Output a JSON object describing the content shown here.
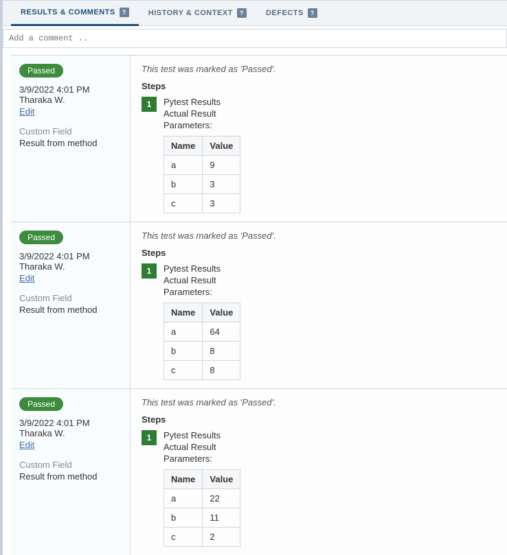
{
  "tabs": {
    "results": "RESULTS & COMMENTS",
    "history": "HISTORY & CONTEXT",
    "defects": "DEFECTS",
    "help_glyph": "?"
  },
  "comment_placeholder": "Add a comment ..",
  "labels": {
    "edit": "Edit",
    "custom_field": "Custom Field",
    "steps": "Steps",
    "name_header": "Name",
    "value_header": "Value"
  },
  "results": [
    {
      "status": "Passed",
      "timestamp": "3/9/2022 4:01 PM Tharaka W.",
      "custom_field_value": "Result from method",
      "marked_text": "This test was marked as 'Passed'.",
      "step_number": "1",
      "step_title": "Pytest Results",
      "step_sub": "Actual Result",
      "params_label": "Parameters:",
      "params": [
        {
          "name": "a",
          "value": "9"
        },
        {
          "name": "b",
          "value": "3"
        },
        {
          "name": "c",
          "value": "3"
        }
      ]
    },
    {
      "status": "Passed",
      "timestamp": "3/9/2022 4:01 PM Tharaka W.",
      "custom_field_value": "Result from method",
      "marked_text": "This test was marked as 'Passed'.",
      "step_number": "1",
      "step_title": "Pytest Results",
      "step_sub": "Actual Result",
      "params_label": "Parameters:",
      "params": [
        {
          "name": "a",
          "value": "64"
        },
        {
          "name": "b",
          "value": "8"
        },
        {
          "name": "c",
          "value": "8"
        }
      ]
    },
    {
      "status": "Passed",
      "timestamp": "3/9/2022 4:01 PM Tharaka W.",
      "custom_field_value": "Result from method",
      "marked_text": "This test was marked as 'Passed'.",
      "step_number": "1",
      "step_title": "Pytest Results",
      "step_sub": "Actual Result",
      "params_label": "Parameters:",
      "params": [
        {
          "name": "a",
          "value": "22"
        },
        {
          "name": "b",
          "value": "11"
        },
        {
          "name": "c",
          "value": "2"
        }
      ]
    }
  ]
}
